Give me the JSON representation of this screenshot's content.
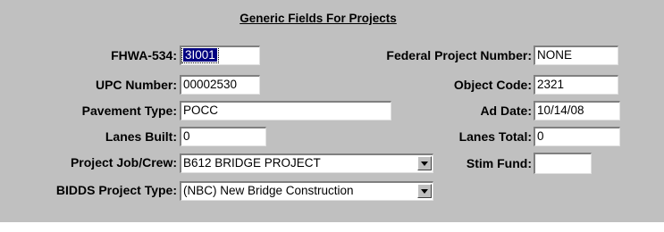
{
  "section_title": "Generic Fields For Projects",
  "fields": {
    "fhwa534": {
      "label": "FHWA-534:",
      "value": "3I001"
    },
    "federal_project_number": {
      "label": "Federal Project Number:",
      "value": "NONE"
    },
    "upc_number": {
      "label": "UPC Number:",
      "value": "00002530"
    },
    "object_code": {
      "label": "Object Code:",
      "value": "2321"
    },
    "pavement_type": {
      "label": "Pavement Type:",
      "value": "POCC"
    },
    "ad_date": {
      "label": "Ad Date:",
      "value": "10/14/08"
    },
    "lanes_built": {
      "label": "Lanes Built:",
      "value": "0"
    },
    "lanes_total": {
      "label": "Lanes Total:",
      "value": "0"
    },
    "project_job_crew": {
      "label": "Project Job/Crew:",
      "value": "B612 BRIDGE PROJECT"
    },
    "stim_fund": {
      "label": "Stim Fund:",
      "value": ""
    },
    "bidds_project_type": {
      "label": "BIDDS Project Type:",
      "value": "(NBC) New Bridge Construction"
    }
  },
  "icons": {
    "dropdown": "chevron-down-icon"
  },
  "colors": {
    "panel": "#c0c0c0",
    "selection": "#000080"
  }
}
